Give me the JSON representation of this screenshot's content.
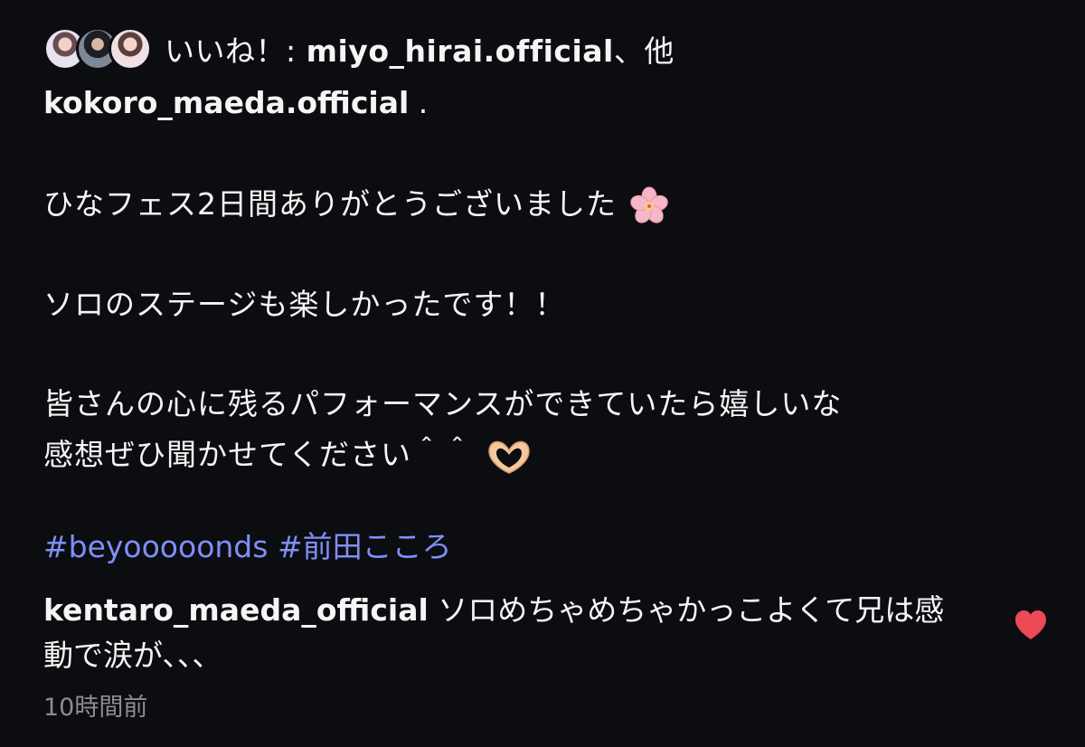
{
  "likes": {
    "prefix": "いいね！: ",
    "first_user": "miyo_hirai.official",
    "suffix": "、他"
  },
  "post": {
    "owner": "kokoro_maeda.official",
    "owner_trailing": " .",
    "caption_lines": [
      "ひなフェス2日間ありがとうございました",
      "ソロのステージも楽しかったです！！",
      "皆さんの心に残るパフォーマンスができていたら嬉しいな",
      "感想ぜひ聞かせてください＾＾"
    ],
    "hashtags": [
      "#beyooooonds",
      "#前田こころ"
    ]
  },
  "comment": {
    "user": "kentaro_maeda_official",
    "text": " ソロめちゃめちゃかっこよくて兄は感動で涙が、、、",
    "time": "10時間前"
  },
  "icons": {
    "flower": "cherry-blossom-icon",
    "hands": "heart-hands-icon",
    "like": "heart-icon"
  },
  "colors": {
    "background": "#0c0d11",
    "hashtag": "#7f8ff6",
    "like_heart": "#ed4956"
  }
}
